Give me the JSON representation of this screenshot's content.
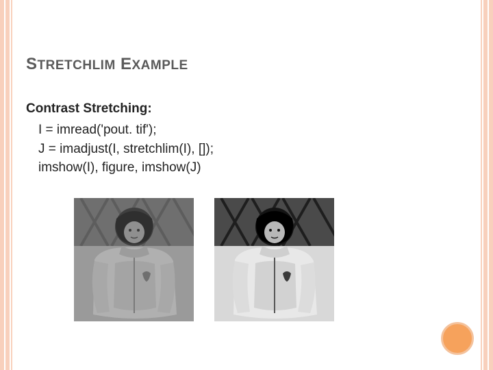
{
  "title": {
    "word1_first": "S",
    "word1_rest": "TRETCHLIM",
    "word2_first": "E",
    "word2_rest": "XAMPLE"
  },
  "subtitle": "Contrast Stretching:",
  "code": {
    "line1": "I = imread('pout. tif');",
    "line2": "J = imadjust(I, stretchlim(I), []);",
    "line3": "imshow(I), figure, imshow(J)"
  },
  "images": {
    "left_alt": "low-contrast-child-photo",
    "right_alt": "stretched-contrast-child-photo"
  },
  "accent_color": "#f6a25c"
}
